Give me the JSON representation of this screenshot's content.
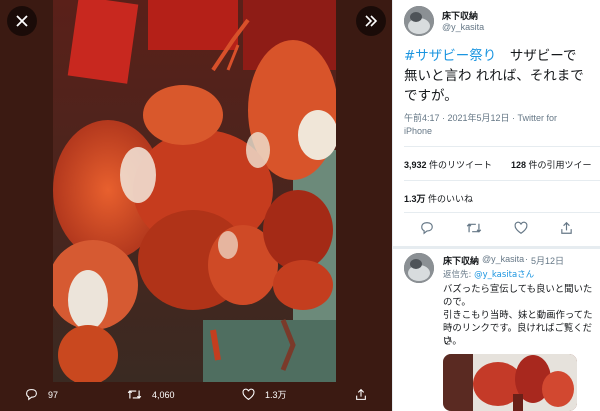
{
  "colors": {
    "accent": "#1b95e0",
    "viewer_background": "#3b1a12",
    "text_primary": "#14171a",
    "text_secondary": "#657786"
  },
  "viewer": {
    "close_icon": "close-icon",
    "expand_icon": "chevron-double-right-icon",
    "actions": [
      {
        "icon": "reply-icon",
        "count": "97"
      },
      {
        "icon": "retweet-icon",
        "count": "4,060"
      },
      {
        "icon": "heart-icon",
        "count": "1.3万"
      },
      {
        "icon": "share-icon",
        "count": ""
      }
    ]
  },
  "tweet": {
    "author_name": "床下収納",
    "author_handle": "@y_kasita",
    "hashtag": "#サザビー祭り",
    "text": "サザビーで無いと言わ れれば、それまでですが。",
    "text_line1_rest": "サザビーで",
    "text_line2": "無いと言わ れれば、それまで",
    "text_line3": "ですが。",
    "meta_line1": "午前4:17 · 2021年5月12日 · Twitter for",
    "meta_line2": "iPhone",
    "retweets_count": "3,932",
    "retweets_label": "件のリツイート",
    "quotes_count": "128",
    "quotes_label": "件の引用ツイー",
    "likes_count": "1.3万",
    "likes_label": "件のいいね"
  },
  "reply": {
    "author_name": "床下収納",
    "author_handle": "@y_kasita",
    "date": "5月12日",
    "reply_to_label": "返信先:",
    "reply_to_handle": "@y_kasitaさん",
    "line1": "バズったら宣伝しても良いと聞いた",
    "line2": "ので。",
    "line3": "引きこもり当時、妹と動画作ってた",
    "line4": "時のリンクです。良ければご覧くださ",
    "line5": "い。"
  }
}
